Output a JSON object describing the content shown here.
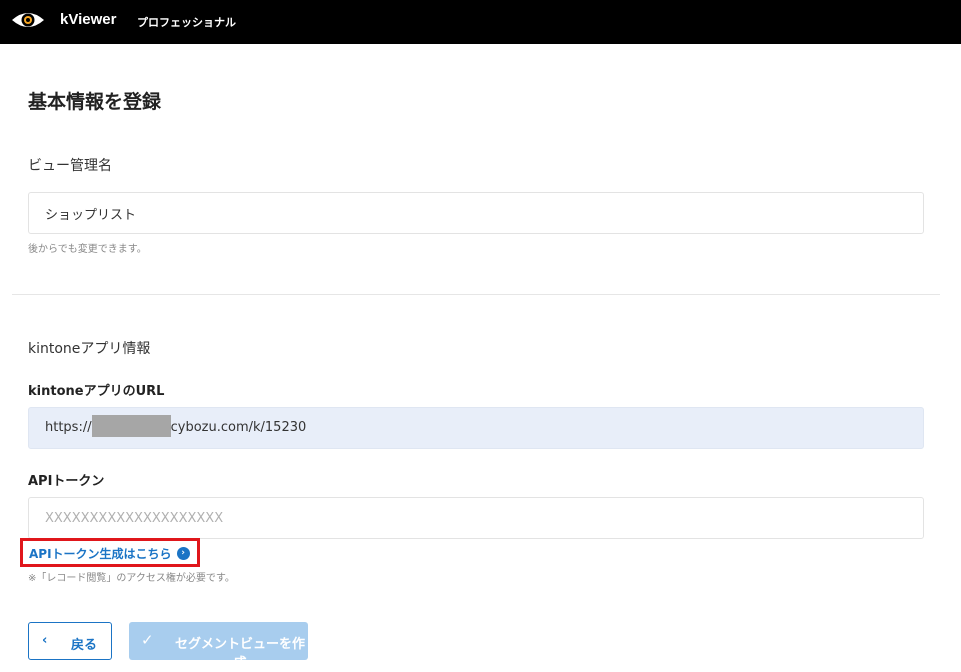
{
  "header": {
    "brand": "kViewer",
    "edition": "プロフェッショナル",
    "logo_icon": "eye-icon"
  },
  "page": {
    "title": "基本情報を登録"
  },
  "view_name": {
    "section_label": "ビュー管理名",
    "value": "ショップリスト",
    "hint": "後からでも変更できます。"
  },
  "kintone": {
    "section_label": "kintoneアプリ情報",
    "url_label": "kintoneアプリのURL",
    "url_prefix": "https://",
    "url_suffix": "cybozu.com/k/15230",
    "token_label": "APIトークン",
    "token_placeholder": "XXXXXXXXXXXXXXXXXXXX",
    "token_link": "APIトークン生成はこちら",
    "token_hint": "※「レコード閲覧」のアクセス権が必要です。"
  },
  "actions": {
    "back_label": "戻る",
    "create_label": "セグメントビューを作成"
  },
  "colors": {
    "topbar": "#000000",
    "accent": "#1b74c5",
    "highlight": "#e0161b",
    "readonly_field": "#e8eef9",
    "disabled_button": "#a8cdee"
  }
}
